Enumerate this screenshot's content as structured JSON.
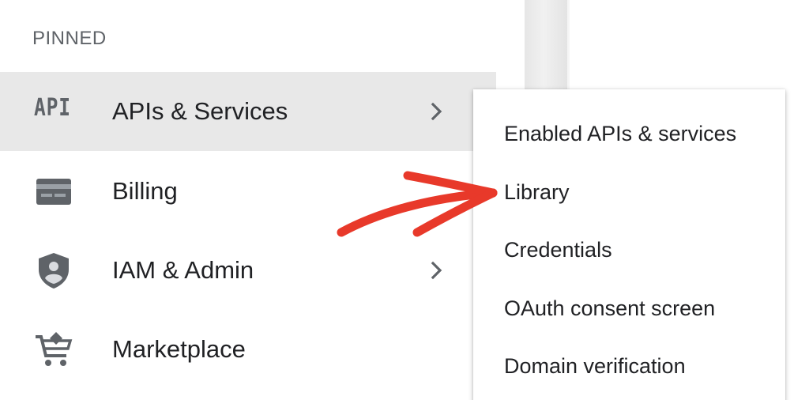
{
  "nav": {
    "section_heading": "PINNED",
    "items": [
      {
        "label": "APIs & Services",
        "icon": "api-icon",
        "icon_text": "API",
        "has_submenu": true,
        "active": true
      },
      {
        "label": "Billing",
        "icon": "billing-card-icon",
        "has_submenu": false,
        "active": false
      },
      {
        "label": "IAM & Admin",
        "icon": "shield-user-icon",
        "has_submenu": true,
        "active": false
      },
      {
        "label": "Marketplace",
        "icon": "cart-icon",
        "has_submenu": false,
        "active": false
      }
    ]
  },
  "submenu": {
    "items": [
      {
        "label": "Enabled APIs & services"
      },
      {
        "label": "Library"
      },
      {
        "label": "Credentials"
      },
      {
        "label": "OAuth consent screen"
      },
      {
        "label": "Domain verification"
      }
    ]
  },
  "colors": {
    "active_row": "#e8e8e8",
    "icon_gray": "#5f6368",
    "text": "#202124",
    "annotation_arrow": "#e8392a"
  }
}
